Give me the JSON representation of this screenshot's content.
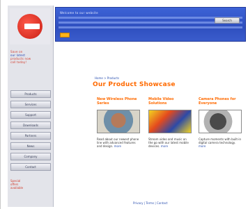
{
  "window": {
    "title": "Our Product Showcase"
  },
  "sidebar": {
    "logo_label": "logo",
    "promo_lines": [
      "Save on",
      "our latest",
      "products now",
      "call today!"
    ],
    "nav_items": [
      "Products",
      "Services",
      "Support",
      "Downloads",
      "Partners",
      "News",
      "Company",
      "Contact"
    ],
    "footer_lines": [
      "Special",
      "offers",
      "available"
    ]
  },
  "banner": {
    "text": "Welcome to our website",
    "search_label": "Search"
  },
  "main": {
    "breadcrumb": "Home > Products",
    "headline": "Our Product Showcase",
    "columns": [
      {
        "title": "New Wireless Phone Series",
        "text": "Read about our newest phone line with advanced features and design.",
        "link": "more"
      },
      {
        "title": "Mobile Video Solutions",
        "text": "Stream video and music on the go with our latest mobile devices.",
        "link": "more"
      },
      {
        "title": "Camera Phones for Everyone",
        "text": "Capture moments with built-in digital camera technology.",
        "link": "more"
      }
    ],
    "footer": "Privacy | Terms | Contact"
  }
}
